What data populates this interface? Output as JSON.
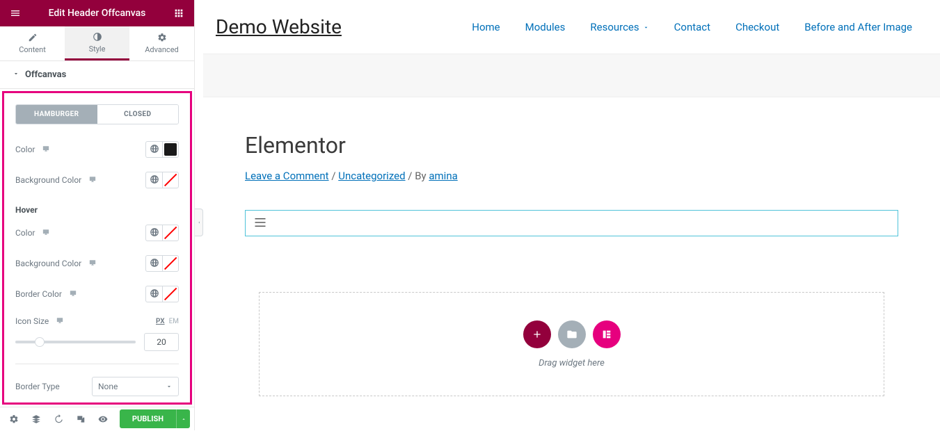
{
  "sidebar": {
    "title": "Edit Header Offcanvas",
    "tabs": {
      "content": "Content",
      "style": "Style",
      "advanced": "Advanced"
    },
    "section": "Offcanvas",
    "toggle": {
      "hamburger": "HAMBURGER",
      "closed": "CLOSED"
    },
    "controls": {
      "color": "Color",
      "background_color": "Background Color",
      "hover": "Hover",
      "hover_color": "Color",
      "hover_bg": "Background Color",
      "border_color": "Border Color",
      "icon_size": "Icon Size",
      "icon_size_value": "20",
      "units_px": "PX",
      "units_em": "EM",
      "border_type": "Border Type",
      "border_type_value": "None"
    },
    "footer": {
      "publish": "PUBLISH"
    }
  },
  "preview": {
    "site_title": "Demo Website",
    "nav": [
      "Home",
      "Modules",
      "Resources",
      "Contact",
      "Checkout",
      "Before and After Image"
    ],
    "heading": "Elementor",
    "meta": {
      "comment": "Leave a Comment",
      "sep1": " / ",
      "category": "Uncategorized",
      "by": " / By ",
      "author": "amina"
    },
    "dropzone_text": "Drag widget here"
  }
}
